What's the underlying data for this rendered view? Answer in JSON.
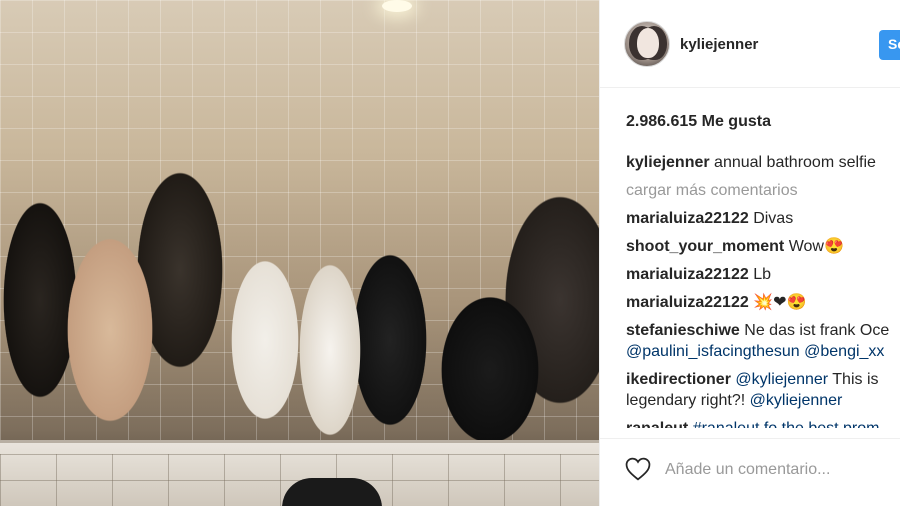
{
  "post": {
    "username": "kyliejenner",
    "follow_label": "Se",
    "likes": "2.986.615 Me gusta"
  },
  "caption": {
    "user": "kyliejenner",
    "text": " annual bathroom selfie"
  },
  "load_more": "cargar más comentarios",
  "comments": [
    {
      "user": "marialuiza22122",
      "text": " Divas"
    },
    {
      "user": "shoot_your_moment",
      "text": " Wow😍"
    },
    {
      "user": "marialuiza22122",
      "text": " Lb"
    },
    {
      "user": "marialuiza22122",
      "text": " 💥❤😍"
    },
    {
      "user": "stefanieschiwe",
      "text": " Ne das ist frank Oce",
      "mentions": [
        "@paulini_isfacingthesun",
        "@bengi_xx"
      ]
    },
    {
      "user": "ikedirectioner",
      "mention1": "@kyliejenner",
      "text": " This is legendary right?! ",
      "mention2": "@kyliejenner"
    },
    {
      "user": "ranaleut",
      "text": " #ranaleut fo the best prom"
    }
  ],
  "footer": {
    "add_comment_placeholder": "Añade un comentario..."
  },
  "colors": {
    "follow_button": "#3897f0",
    "mention": "#003569",
    "muted": "#999999"
  }
}
